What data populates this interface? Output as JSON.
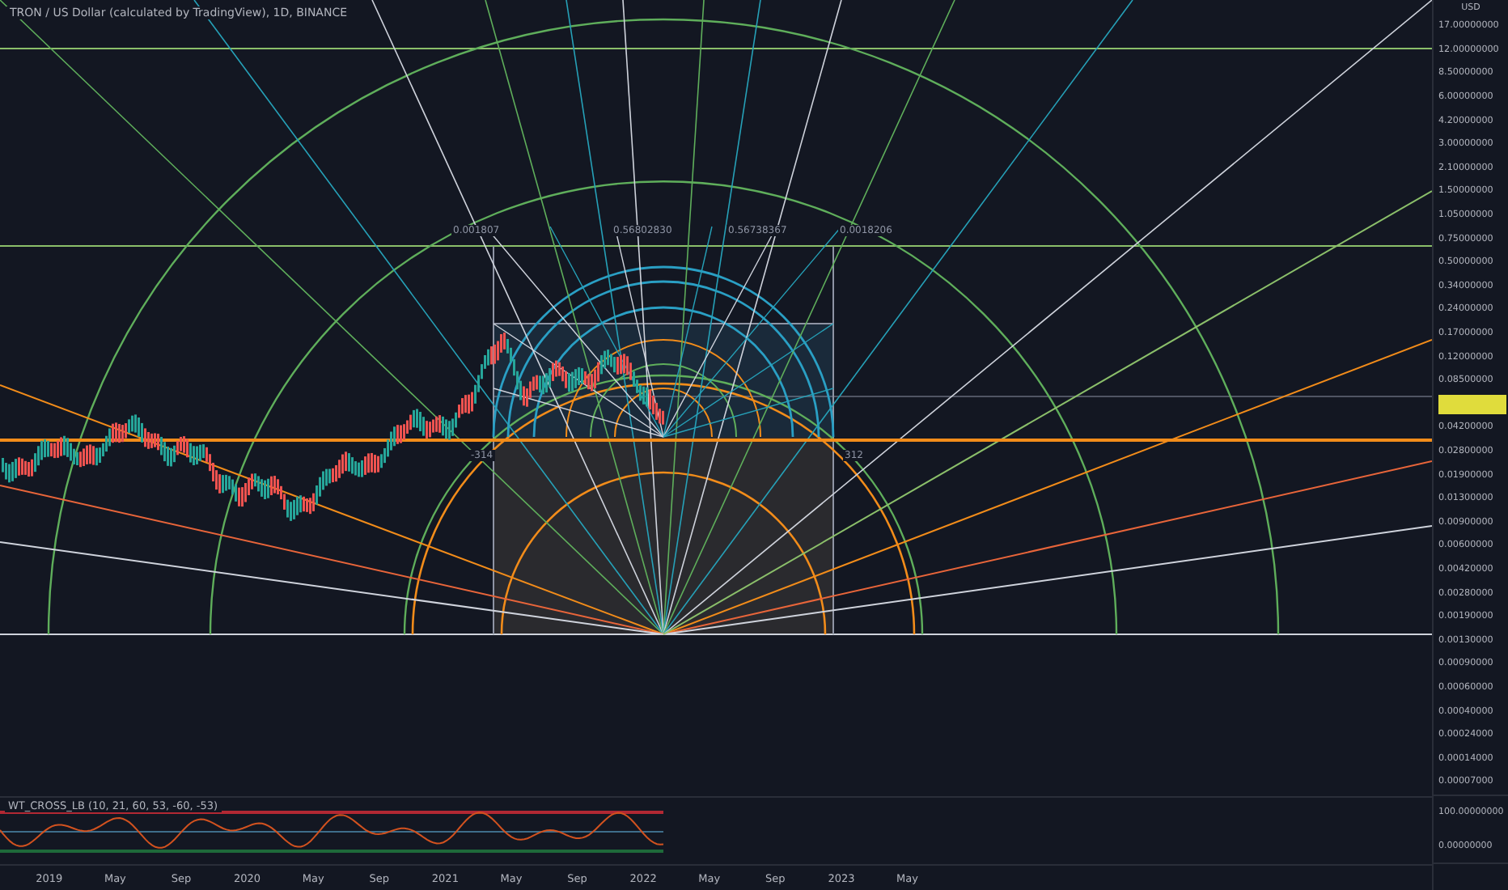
{
  "header": {
    "title": "TRON / US Dollar (calculated by TradingView), 1D, BINANCE"
  },
  "annotations": [
    {
      "text": "0.001807"
    },
    {
      "text": "0.56802830"
    },
    {
      "text": "0.56738367"
    },
    {
      "text": "0.0018206"
    },
    {
      "text": "-314"
    },
    {
      "text": "312"
    }
  ],
  "price_axis": {
    "unit": "USD",
    "labels": [
      {
        "kind": "tick",
        "text": "17.00000000"
      },
      {
        "kind": "tick",
        "text": "12.00000000"
      },
      {
        "kind": "tick",
        "text": "8.50000000"
      },
      {
        "kind": "tick",
        "text": "6.00000000"
      },
      {
        "kind": "tick",
        "text": "4.20000000"
      },
      {
        "kind": "tick",
        "text": "3.00000000"
      },
      {
        "kind": "tick",
        "text": "2.10000000"
      },
      {
        "kind": "tick",
        "text": "1.50000000"
      },
      {
        "kind": "tick",
        "text": "1.05000000"
      },
      {
        "kind": "tick",
        "text": "0.75000000"
      },
      {
        "kind": "tick",
        "text": "0.50000000"
      },
      {
        "kind": "tick",
        "text": "0.34000000"
      },
      {
        "kind": "tick",
        "text": "0.24000000"
      },
      {
        "kind": "tick",
        "text": "0.17000000"
      },
      {
        "kind": "tick",
        "text": "0.12000000"
      },
      {
        "kind": "tick",
        "text": "0.08500000"
      },
      {
        "kind": "current_price"
      },
      {
        "kind": "tick",
        "text": "0.04200000"
      },
      {
        "kind": "tick",
        "text": "0.02800000"
      },
      {
        "kind": "tick",
        "text": "0.01900000"
      },
      {
        "kind": "tick",
        "text": "0.01300000"
      },
      {
        "kind": "tick",
        "text": "0.00900000"
      },
      {
        "kind": "tick",
        "text": "0.00600000"
      },
      {
        "kind": "tick",
        "text": "0.00420000"
      },
      {
        "kind": "tick",
        "text": "0.00280000"
      },
      {
        "kind": "tick",
        "text": "0.00190000"
      },
      {
        "kind": "tick",
        "text": "0.00130000"
      },
      {
        "kind": "tick",
        "text": "0.00090000"
      },
      {
        "kind": "tick",
        "text": "0.00060000"
      },
      {
        "kind": "tick",
        "text": "0.00040000"
      },
      {
        "kind": "tick",
        "text": "0.00024000"
      },
      {
        "kind": "tick",
        "text": "0.00014000"
      },
      {
        "kind": "tick",
        "text": "0.00007000"
      }
    ]
  },
  "indicator": {
    "title": "WT_CROSS_LB (10, 21, 60, 53, -60, -53)",
    "axis_labels": [
      "100.00000000",
      "0.00000000"
    ]
  },
  "time_axis": {
    "labels": [
      "2019",
      "May",
      "Sep",
      "2020",
      "May",
      "Sep",
      "2021",
      "May",
      "Sep",
      "2022",
      "May",
      "Sep",
      "2023",
      "May"
    ]
  }
}
